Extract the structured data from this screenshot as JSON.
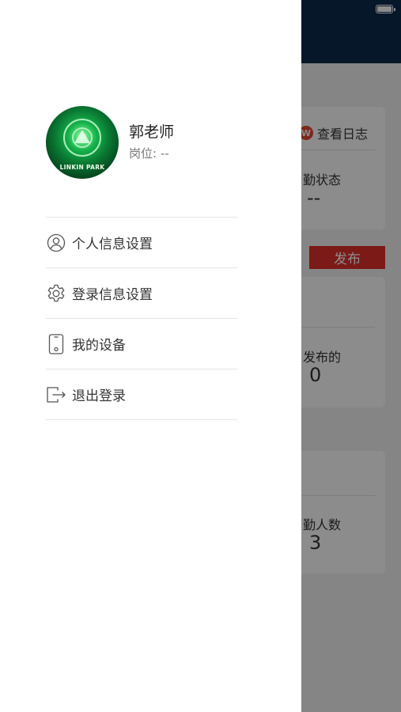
{
  "background": {
    "log_link_label": "查看日志",
    "log_icon_glyph": "W",
    "status_label": "勤状态",
    "status_value": "--",
    "publish_button_label": "发布",
    "published_label": "发布的",
    "published_value": "0",
    "attendance_label": "勤人数",
    "attendance_value": "3"
  },
  "drawer": {
    "profile": {
      "avatar_caption": "LINKIN PARK",
      "name": "郭老师",
      "position": "岗位: --"
    },
    "menu": [
      {
        "label": "个人信息设置",
        "icon": "user-circle-icon"
      },
      {
        "label": "登录信息设置",
        "icon": "gear-icon"
      },
      {
        "label": "我的设备",
        "icon": "phone-device-icon"
      },
      {
        "label": "退出登录",
        "icon": "logout-icon"
      }
    ]
  },
  "colors": {
    "header_bg": "#0d2a4e",
    "publish_button": "#e0302a",
    "log_icon": "#e0492e"
  }
}
